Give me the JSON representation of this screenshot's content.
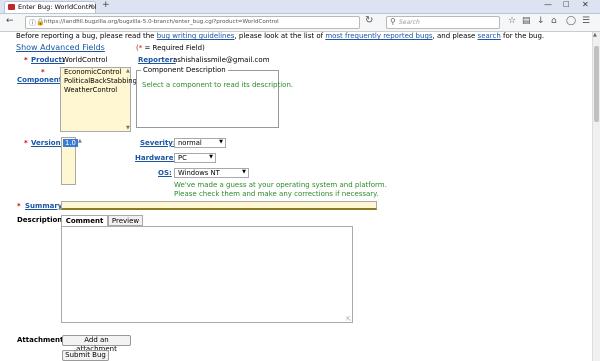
{
  "browser": {
    "tab_title": "Enter Bug: WorldControl",
    "tab_close": "×",
    "new_tab": "+",
    "url": "https://landfill.bugzilla.org/bugzilla-5.0-branch/enter_bug.cgi?product=WorldControl",
    "search_placeholder": "Search",
    "icons": [
      "back-icon",
      "info-icon",
      "lock-icon",
      "reload-icon",
      "search-icon",
      "star-icon",
      "reading-list-icon",
      "download-icon",
      "home-icon",
      "pocket-icon",
      "menu-icon"
    ]
  },
  "page": {
    "intro_before": "Before reporting a bug, please read the ",
    "intro_link1": "bug writing guidelines",
    "intro_mid1": ", please look at the list of ",
    "intro_link2": "most frequently reported bugs",
    "intro_mid2": ", and please ",
    "intro_link3": "search",
    "intro_after": " for the bug.",
    "advanced_link": "Show Advanced Fields",
    "required_note_open": "(",
    "required_note_star": "*",
    "required_note_rest": " = Required Field)",
    "star": "*",
    "product_label": "Product:",
    "product_value": "WorldControl",
    "reporter_label": "Reporter:",
    "reporter_value": "ashishalissmile@gmail.com",
    "component_label": "Component:",
    "components": [
      "EconomicControl",
      "PoliticalBackStabbing",
      "WeatherControl"
    ],
    "component_desc_legend": "Component Description",
    "component_desc_text": "Select a component to read its description.",
    "version_label": "Version:",
    "version_value": "1.0",
    "severity_label": "Severity:",
    "severity_value": "normal",
    "hardware_label": "Hardware:",
    "hardware_value": "PC",
    "os_label": "OS:",
    "os_value": "Windows NT",
    "os_guess": "We've made a guess at your operating system and platform. Please check them and make any corrections if necessary.",
    "summary_label": "Summary:",
    "description_label": "Description:",
    "tab_comment": "Comment",
    "tab_preview": "Preview",
    "attachment_label": "Attachment:",
    "attach_button": "Add an attachment",
    "submit_button": "Submit Bug"
  },
  "colors": {
    "link": "#1b55a3",
    "required": "#cc0000",
    "hint": "#2a8a2a",
    "field_bg": "#fff7d1"
  }
}
